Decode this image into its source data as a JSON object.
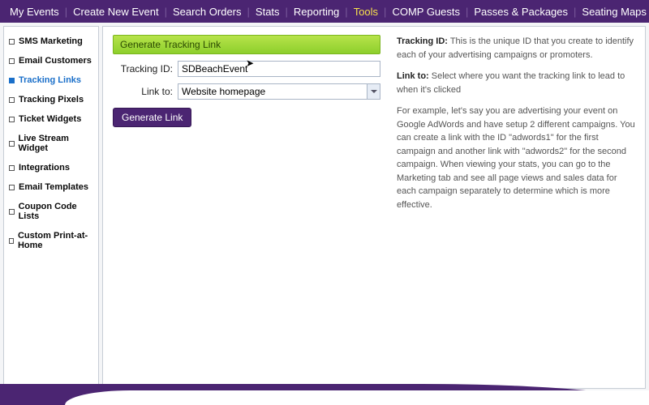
{
  "topnav": {
    "items": [
      {
        "label": "My Events"
      },
      {
        "label": "Create New Event"
      },
      {
        "label": "Search Orders"
      },
      {
        "label": "Stats"
      },
      {
        "label": "Reporting"
      },
      {
        "label": "Tools",
        "active": true
      },
      {
        "label": "COMP Guests"
      },
      {
        "label": "Passes & Packages"
      },
      {
        "label": "Seating Maps"
      }
    ]
  },
  "sidebar": {
    "items": [
      {
        "label": "SMS Marketing"
      },
      {
        "label": "Email Customers"
      },
      {
        "label": "Tracking Links",
        "active": true
      },
      {
        "label": "Tracking Pixels"
      },
      {
        "label": "Ticket Widgets"
      },
      {
        "label": "Live Stream Widget"
      },
      {
        "label": "Integrations"
      },
      {
        "label": "Email Templates"
      },
      {
        "label": "Coupon Code Lists"
      },
      {
        "label": "Custom Print-at-Home"
      }
    ]
  },
  "panel": {
    "title": "Generate Tracking Link",
    "label_tracking_id": "Tracking ID:",
    "value_tracking_id": "SDBeachEvent",
    "label_link_to": "Link to:",
    "value_link_to": "Website homepage",
    "button_label": "Generate Link"
  },
  "help": {
    "p1_label": "Tracking ID:",
    "p1_text": " This is the unique ID that you create to identify each of your advertising campaigns or promoters.",
    "p2_label": "Link to:",
    "p2_text": " Select where you want the tracking link to lead to when it's clicked",
    "p3_text": "For example, let's say you are advertising your event on Google AdWords and have setup 2 different campaigns. You can create a link with the ID \"adwords1\" for the first campaign and another link with \"adwords2\" for the second campaign. When viewing your stats, you can go to the Marketing tab and see all page views and sales data for each campaign separately to determine which is more effective."
  }
}
